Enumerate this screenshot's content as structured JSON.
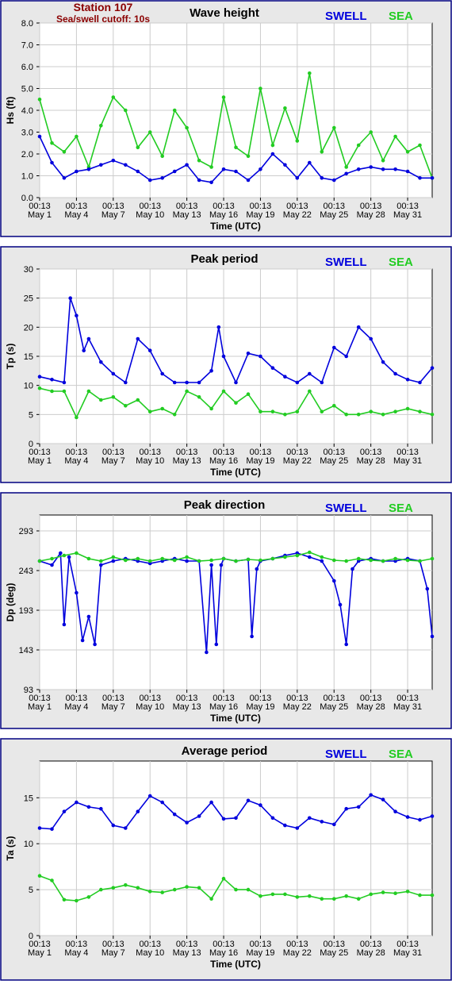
{
  "header": {
    "station": "Station 107",
    "cutoff": "Sea/swell cutoff: 10s"
  },
  "colors": {
    "swell": "#0000dd",
    "sea": "#22cc22",
    "panel_bg": "#e8e8e8",
    "frame": "#000080",
    "grid": "#cccccc"
  },
  "shared": {
    "xlabel": "Time (UTC)",
    "x_ticks": [
      {
        "top": "00:13",
        "bottom": "May 1"
      },
      {
        "top": "00:13",
        "bottom": "May 4"
      },
      {
        "top": "00:13",
        "bottom": "May 7"
      },
      {
        "top": "00:13",
        "bottom": "May 10"
      },
      {
        "top": "00:13",
        "bottom": "May 13"
      },
      {
        "top": "00:13",
        "bottom": "May 16"
      },
      {
        "top": "00:13",
        "bottom": "May 19"
      },
      {
        "top": "00:13",
        "bottom": "May 22"
      },
      {
        "top": "00:13",
        "bottom": "May 25"
      },
      {
        "top": "00:13",
        "bottom": "May 28"
      },
      {
        "top": "00:13",
        "bottom": "May 31"
      }
    ],
    "x_range_days": [
      1,
      33
    ]
  },
  "chart_data": [
    {
      "type": "line",
      "title": "Wave height",
      "ylabel": "Hs (ft)",
      "ylim": [
        0,
        8
      ],
      "yticks": [
        "0.0",
        "1.0",
        "2.0",
        "3.0",
        "4.0",
        "5.0",
        "6.0",
        "7.0",
        "8.0"
      ],
      "ytick_values": [
        0,
        1,
        2,
        3,
        4,
        5,
        6,
        7,
        8
      ],
      "legend": [
        "SWELL",
        "SEA"
      ],
      "series": [
        {
          "name": "SWELL",
          "x": [
            1,
            2,
            3,
            4,
            5,
            6,
            7,
            8,
            9,
            10,
            11,
            12,
            13,
            14,
            15,
            16,
            17,
            18,
            19,
            20,
            21,
            22,
            23,
            24,
            25,
            26,
            27,
            28,
            29,
            30,
            31,
            32,
            33
          ],
          "values": [
            2.8,
            1.6,
            0.9,
            1.2,
            1.3,
            1.5,
            1.7,
            1.5,
            1.2,
            0.8,
            0.9,
            1.2,
            1.5,
            0.8,
            0.7,
            1.3,
            1.2,
            0.8,
            1.3,
            2.0,
            1.5,
            0.9,
            1.6,
            0.9,
            0.8,
            1.1,
            1.3,
            1.4,
            1.3,
            1.3,
            1.2,
            0.9,
            0.9
          ]
        },
        {
          "name": "SEA",
          "x": [
            1,
            2,
            3,
            4,
            5,
            6,
            7,
            8,
            9,
            10,
            11,
            12,
            13,
            14,
            15,
            16,
            17,
            18,
            19,
            20,
            21,
            22,
            23,
            24,
            25,
            26,
            27,
            28,
            29,
            30,
            31,
            32,
            33
          ],
          "values": [
            4.5,
            2.5,
            2.1,
            2.8,
            1.4,
            3.3,
            4.6,
            4.0,
            2.3,
            3.0,
            1.9,
            4.0,
            3.2,
            1.7,
            1.4,
            4.6,
            2.3,
            1.9,
            5.0,
            2.4,
            4.1,
            2.6,
            5.7,
            2.1,
            3.2,
            1.4,
            2.4,
            3.0,
            1.7,
            2.8,
            2.1,
            2.4,
            0.9
          ]
        }
      ]
    },
    {
      "type": "line",
      "title": "Peak period",
      "ylabel": "Tp (s)",
      "ylim": [
        0,
        30
      ],
      "yticks": [
        "0",
        "5",
        "10",
        "15",
        "20",
        "25",
        "30"
      ],
      "ytick_values": [
        0,
        5,
        10,
        15,
        20,
        25,
        30
      ],
      "legend": [
        "SWELL",
        "SEA"
      ],
      "series": [
        {
          "name": "SWELL",
          "x": [
            1,
            2,
            3,
            3.5,
            4,
            4.6,
            5,
            6,
            7,
            8,
            9,
            10,
            11,
            12,
            13,
            14,
            15,
            15.6,
            16,
            17,
            18,
            19,
            20,
            21,
            22,
            23,
            24,
            25,
            26,
            27,
            28,
            29,
            30,
            31,
            32,
            33
          ],
          "values": [
            11.5,
            11.0,
            10.5,
            25.0,
            22.0,
            16.0,
            18.0,
            14.0,
            12.0,
            10.5,
            18.0,
            16.0,
            12.0,
            10.5,
            10.5,
            10.5,
            12.5,
            20.0,
            15.0,
            10.5,
            15.5,
            15.0,
            13.0,
            11.5,
            10.5,
            12.0,
            10.5,
            16.5,
            15.0,
            20.0,
            18.0,
            14.0,
            12.0,
            11.0,
            10.5,
            13.0
          ]
        },
        {
          "name": "SEA",
          "x": [
            1,
            2,
            3,
            4,
            5,
            6,
            7,
            8,
            9,
            10,
            11,
            12,
            13,
            14,
            15,
            16,
            17,
            18,
            19,
            20,
            21,
            22,
            23,
            24,
            25,
            26,
            27,
            28,
            29,
            30,
            31,
            32,
            33
          ],
          "values": [
            9.5,
            9.0,
            9.0,
            4.5,
            9.0,
            7.5,
            8.0,
            6.5,
            7.5,
            5.5,
            6.0,
            5.0,
            9.0,
            8.0,
            6.0,
            9.0,
            7.0,
            8.5,
            5.5,
            5.5,
            5.0,
            5.5,
            9.0,
            5.5,
            6.5,
            5.0,
            5.0,
            5.5,
            5.0,
            5.5,
            6.0,
            5.5,
            5.0
          ]
        }
      ]
    },
    {
      "type": "line",
      "title": "Peak direction",
      "ylabel": "Dp (deg)",
      "ylim": [
        93,
        313
      ],
      "yticks": [
        "93",
        "143",
        "193",
        "243",
        "293"
      ],
      "ytick_values": [
        93,
        143,
        193,
        243,
        293
      ],
      "legend": [
        "SWELL",
        "SEA"
      ],
      "series": [
        {
          "name": "SWELL",
          "x": [
            1,
            2,
            2.7,
            3,
            3.4,
            4,
            4.5,
            5,
            5.5,
            6,
            7,
            8,
            9,
            10,
            11,
            12,
            13,
            14,
            14.6,
            15,
            15.4,
            15.8,
            16,
            17,
            18,
            18.3,
            18.7,
            19,
            20,
            21,
            22,
            23,
            24,
            25,
            25.5,
            26,
            26.5,
            27,
            28,
            29,
            30,
            31,
            32,
            32.6,
            33
          ],
          "values": [
            255,
            250,
            265,
            175,
            260,
            215,
            155,
            185,
            150,
            250,
            255,
            258,
            255,
            252,
            255,
            258,
            255,
            255,
            140,
            250,
            150,
            250,
            258,
            255,
            257,
            160,
            245,
            255,
            258,
            262,
            265,
            260,
            255,
            230,
            200,
            150,
            245,
            255,
            258,
            255,
            255,
            258,
            255,
            220,
            160
          ]
        },
        {
          "name": "SEA",
          "x": [
            1,
            2,
            3,
            4,
            5,
            6,
            7,
            8,
            9,
            10,
            11,
            12,
            13,
            14,
            15,
            16,
            17,
            18,
            19,
            20,
            21,
            22,
            23,
            24,
            25,
            26,
            27,
            28,
            29,
            30,
            31,
            32,
            33
          ],
          "values": [
            255,
            258,
            262,
            265,
            258,
            255,
            260,
            256,
            258,
            255,
            258,
            256,
            260,
            255,
            256,
            258,
            255,
            257,
            256,
            258,
            260,
            262,
            266,
            260,
            256,
            255,
            258,
            256,
            255,
            258,
            256,
            255,
            258
          ]
        }
      ]
    },
    {
      "type": "line",
      "title": "Average period",
      "ylabel": "Ta (s)",
      "ylim": [
        0,
        19
      ],
      "yticks": [
        "0",
        "5",
        "10",
        "15"
      ],
      "ytick_values": [
        0,
        5,
        10,
        15
      ],
      "legend": [
        "SWELL",
        "SEA"
      ],
      "series": [
        {
          "name": "SWELL",
          "x": [
            1,
            2,
            3,
            4,
            5,
            6,
            7,
            8,
            9,
            10,
            11,
            12,
            13,
            14,
            15,
            16,
            17,
            18,
            19,
            20,
            21,
            22,
            23,
            24,
            25,
            26,
            27,
            28,
            29,
            30,
            31,
            32,
            33
          ],
          "values": [
            11.7,
            11.6,
            13.5,
            14.5,
            14.0,
            13.8,
            12.0,
            11.7,
            13.5,
            15.2,
            14.5,
            13.2,
            12.3,
            13.0,
            14.5,
            12.7,
            12.8,
            14.7,
            14.2,
            12.8,
            12.0,
            11.7,
            12.8,
            12.4,
            12.1,
            13.8,
            14.0,
            15.3,
            14.8,
            13.5,
            12.9,
            12.6,
            13.0
          ]
        },
        {
          "name": "SEA",
          "x": [
            1,
            2,
            3,
            4,
            5,
            6,
            7,
            8,
            9,
            10,
            11,
            12,
            13,
            14,
            15,
            16,
            17,
            18,
            19,
            20,
            21,
            22,
            23,
            24,
            25,
            26,
            27,
            28,
            29,
            30,
            31,
            32,
            33
          ],
          "values": [
            6.5,
            6.0,
            3.9,
            3.8,
            4.2,
            5.0,
            5.2,
            5.5,
            5.2,
            4.8,
            4.7,
            5.0,
            5.3,
            5.2,
            4.0,
            6.2,
            5.0,
            5.0,
            4.3,
            4.5,
            4.5,
            4.2,
            4.3,
            4.0,
            4.0,
            4.3,
            4.0,
            4.5,
            4.7,
            4.6,
            4.8,
            4.4,
            4.4
          ]
        }
      ]
    }
  ]
}
